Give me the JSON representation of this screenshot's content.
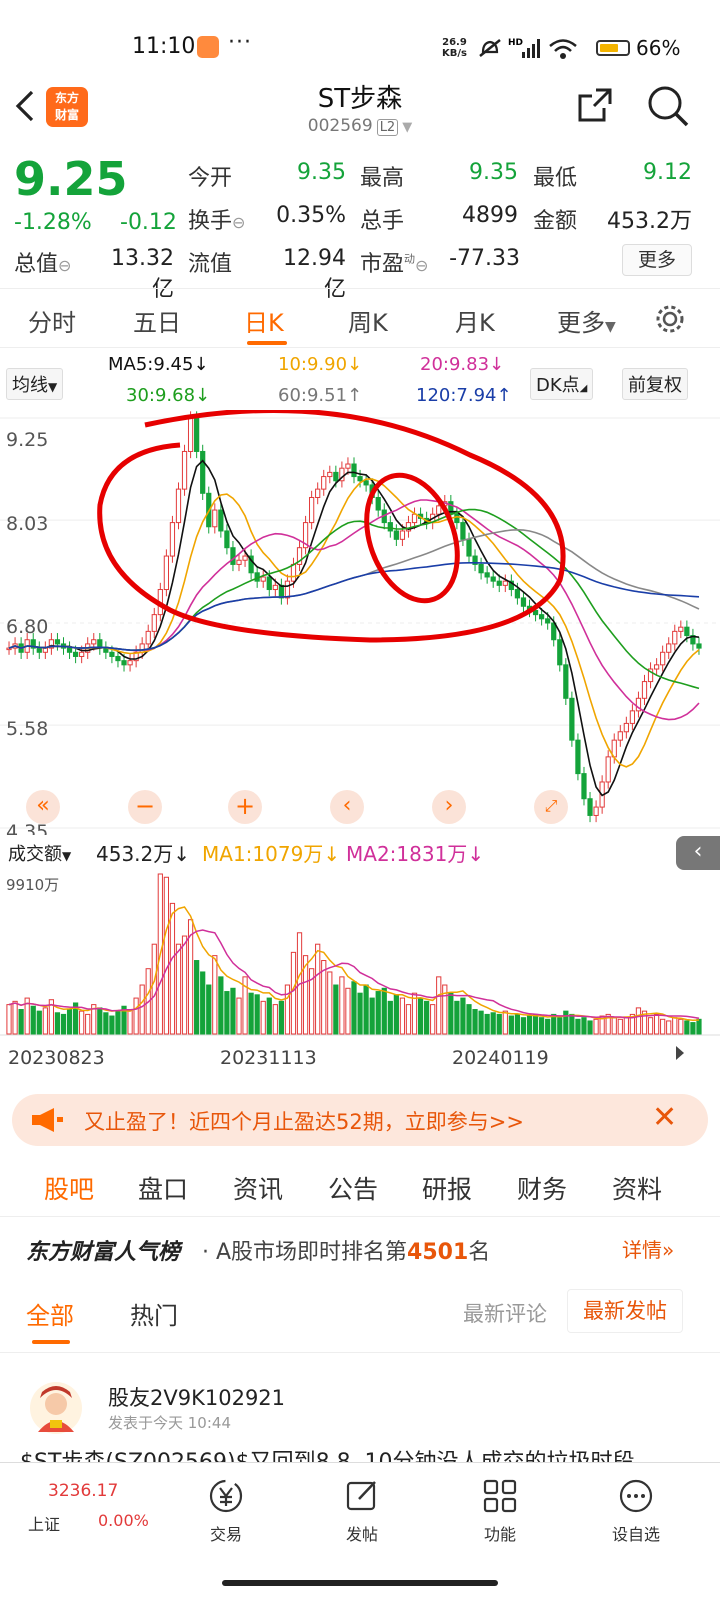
{
  "status_bar": {
    "time": "11:10",
    "more": "···",
    "net_speed_value": "26.9",
    "net_speed_unit": "KB/s",
    "battery": "66%"
  },
  "header": {
    "title": "ST步森",
    "code": "002569",
    "level_badge": "L2",
    "logo_line1": "东方",
    "logo_line2": "财富"
  },
  "quote": {
    "price": "9.25",
    "change_pct": "-1.28%",
    "change": "-0.12",
    "open_label": "今开",
    "open": "9.35",
    "high_label": "最高",
    "high": "9.35",
    "low_label": "最低",
    "low": "9.12",
    "turnover_label": "换手",
    "turnover": "0.35%",
    "volume_label": "总手",
    "volume": "4899",
    "amount_label": "金额",
    "amount": "453.2万",
    "mktcap_label": "总值",
    "mktcap": "13.32亿",
    "float_label": "流值",
    "float_cap": "12.94亿",
    "pe_label": "市盈",
    "pe_sup": "动",
    "pe": "-77.33",
    "more_label": "更多"
  },
  "chart_tabs": [
    "分时",
    "五日",
    "日K",
    "周K",
    "月K",
    "更多"
  ],
  "ma_row": {
    "selector": "均线",
    "ma5": "MA5:9.45",
    "ma10": "10:9.90",
    "ma20": "20:9.83",
    "ma30": "30:9.68",
    "ma60": "60:9.51",
    "ma120": "120:7.94",
    "dk_btn": "DK点",
    "adjust_btn": "前复权"
  },
  "colors": {
    "up": "#e23a3a",
    "down": "#14a33a",
    "ma5": "#111111",
    "ma10": "#f0a500",
    "ma20": "#d0309a",
    "ma30": "#1e9e1e",
    "ma60": "#888888",
    "ma120": "#1a3ea8",
    "accent": "#ff6a00"
  },
  "chart_data": {
    "type": "candlestick",
    "y_ticks": [
      "9.25",
      "8.03",
      "6.80",
      "5.58",
      "4.35"
    ],
    "ylim": [
      4.35,
      9.25
    ],
    "x_ticks": [
      "20230823",
      "20231113",
      "20240119"
    ],
    "closes": [
      6.5,
      6.55,
      6.45,
      6.6,
      6.5,
      6.45,
      6.5,
      6.6,
      6.55,
      6.5,
      6.45,
      6.4,
      6.45,
      6.55,
      6.6,
      6.5,
      6.45,
      6.4,
      6.35,
      6.3,
      6.35,
      6.45,
      6.55,
      6.7,
      6.9,
      7.2,
      7.6,
      8.0,
      8.4,
      8.85,
      9.25,
      8.85,
      8.35,
      7.95,
      8.15,
      7.9,
      7.7,
      7.5,
      7.55,
      7.6,
      7.4,
      7.3,
      7.35,
      7.2,
      7.25,
      7.1,
      7.3,
      7.5,
      7.7,
      8.0,
      8.3,
      8.4,
      8.55,
      8.6,
      8.5,
      8.65,
      8.7,
      8.55,
      8.5,
      8.45,
      8.3,
      8.15,
      8.0,
      7.9,
      7.8,
      7.9,
      8.0,
      8.1,
      8.05,
      8.0,
      8.1,
      8.2,
      8.25,
      8.1,
      8.0,
      7.8,
      7.6,
      7.5,
      7.4,
      7.35,
      7.3,
      7.25,
      7.3,
      7.2,
      7.1,
      7.0,
      6.95,
      6.9,
      6.85,
      6.8,
      6.6,
      6.3,
      5.9,
      5.4,
      5.0,
      4.7,
      4.5,
      4.6,
      4.9,
      5.2,
      5.4,
      5.5,
      5.6,
      5.75,
      5.9,
      6.1,
      6.25,
      6.3,
      6.45,
      6.55,
      6.7,
      6.75,
      6.65,
      6.55,
      6.5
    ]
  },
  "volume_row": {
    "label": "成交额",
    "value": "453.2万",
    "ma1": "MA1:1079万",
    "ma2": "MA2:1831万",
    "max_tick": "9910万"
  },
  "volume_data": [
    18,
    20,
    15,
    22,
    17,
    14,
    16,
    21,
    13,
    12,
    15,
    19,
    14,
    12,
    18,
    16,
    13,
    11,
    14,
    17,
    15,
    22,
    30,
    40,
    55,
    98,
    96,
    80,
    55,
    60,
    70,
    45,
    38,
    30,
    48,
    35,
    26,
    28,
    22,
    35,
    25,
    24,
    20,
    22,
    18,
    20,
    30,
    50,
    62,
    48,
    40,
    55,
    45,
    38,
    30,
    35,
    28,
    32,
    25,
    30,
    22,
    26,
    28,
    20,
    24,
    22,
    18,
    25,
    22,
    20,
    18,
    35,
    30,
    25,
    20,
    22,
    18,
    15,
    14,
    12,
    13,
    12,
    14,
    11,
    12,
    10,
    11,
    12,
    10,
    9,
    12,
    10,
    14,
    12,
    9,
    10,
    8,
    9,
    11,
    12,
    10,
    9,
    10,
    12,
    16,
    14,
    10,
    12,
    9,
    8,
    10,
    9,
    8,
    7,
    9
  ],
  "banner": {
    "text": "又止盈了！近四个月止盈达52期，立即参与>>"
  },
  "lower_tabs": [
    "股吧",
    "盘口",
    "资讯",
    "公告",
    "研报",
    "财务",
    "资料"
  ],
  "popularity": {
    "brand": "东方财富人气榜",
    "text_prefix": "· A股市场即时排名第",
    "rank": "4501",
    "text_suffix": "名",
    "detail": "详情"
  },
  "forum_tabs": {
    "all": "全部",
    "hot": "热门",
    "latest_comment": "最新评论",
    "latest_post": "最新发帖"
  },
  "post": {
    "author": "股友2V9K102921",
    "time": "发表于今天 10:44",
    "preview": "$ST步森(SZ002569)$又回到8.8, 10分钟没人成交的垃圾时段"
  },
  "bottom_nav": {
    "index_value": "3236.17",
    "index_name": "上证",
    "index_change": "0.00%",
    "trade": "交易",
    "post": "发帖",
    "features": "功能",
    "watchlist": "设自选"
  }
}
